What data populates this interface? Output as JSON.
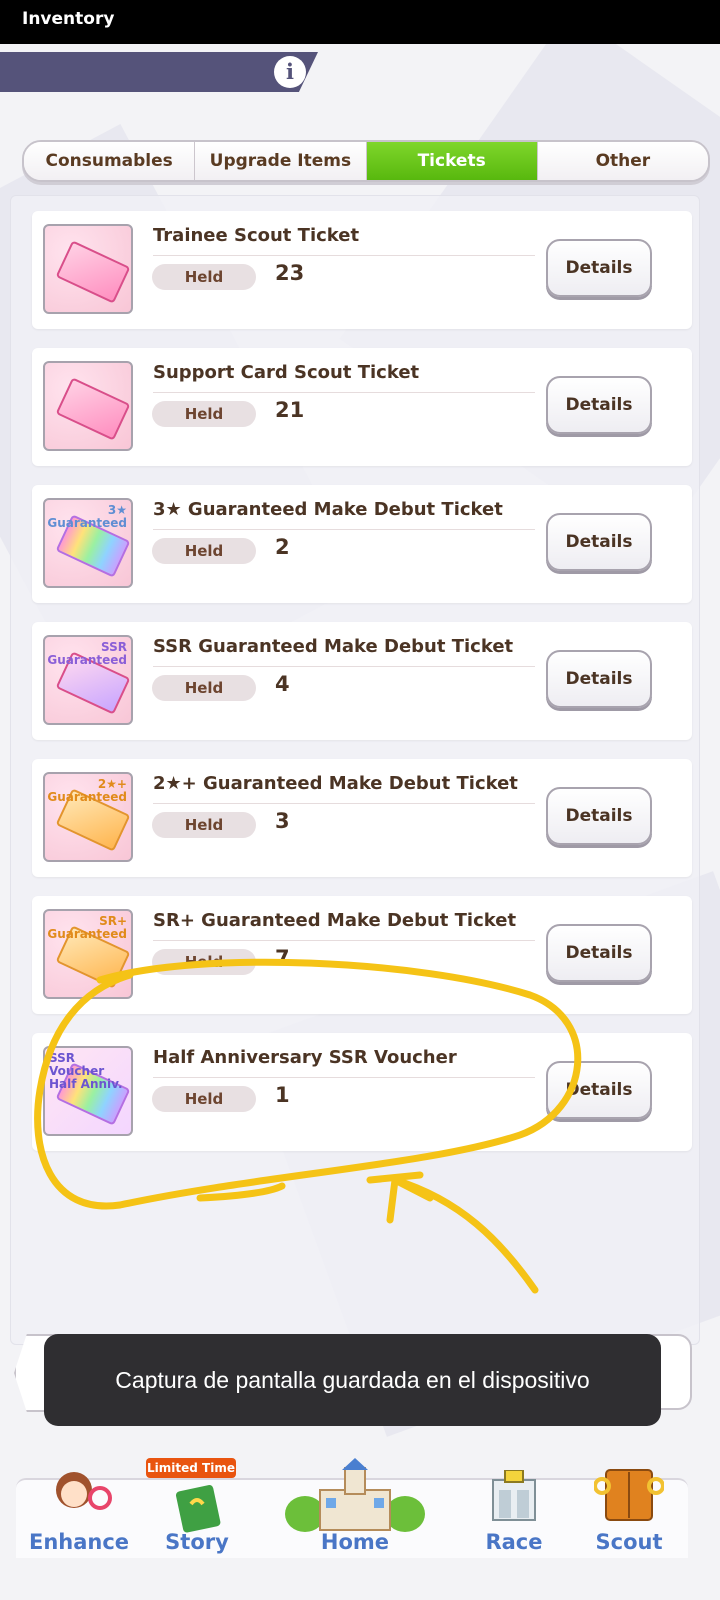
{
  "header": {
    "title": "Inventory",
    "info_icon": "info-icon",
    "info_glyph": "i"
  },
  "tabs": [
    {
      "label": "Consumables",
      "active": false
    },
    {
      "label": "Upgrade Items",
      "active": false
    },
    {
      "label": "Tickets",
      "active": true
    },
    {
      "label": "Other",
      "active": false
    }
  ],
  "colors": {
    "accent_tab": "#6cc81d",
    "banner": "#55537a",
    "annotation": "#f5c316",
    "toast_bg": "#2f2e31"
  },
  "items": [
    {
      "name": "Trainee Scout Ticket",
      "held_label": "Held",
      "count": "23",
      "details_label": "Details",
      "icon": "trainee-scout-ticket-icon"
    },
    {
      "name": "Support Card Scout Ticket",
      "held_label": "Held",
      "count": "21",
      "details_label": "Details",
      "icon": "support-card-scout-ticket-icon"
    },
    {
      "name": "3★ Guaranteed Make Debut Ticket",
      "held_label": "Held",
      "count": "2",
      "details_label": "Details",
      "icon": "three-star-guaranteed-ticket-icon",
      "tag": "3★",
      "tag2": "Guaranteed"
    },
    {
      "name": "SSR Guaranteed Make Debut Ticket",
      "held_label": "Held",
      "count": "4",
      "details_label": "Details",
      "icon": "ssr-guaranteed-ticket-icon",
      "tag": "SSR",
      "tag2": "Guaranteed"
    },
    {
      "name": "2★+ Guaranteed Make Debut Ticket",
      "held_label": "Held",
      "count": "3",
      "details_label": "Details",
      "icon": "two-star-plus-guaranteed-ticket-icon",
      "tag": "2★+",
      "tag2": "Guaranteed"
    },
    {
      "name": "SR+ Guaranteed Make Debut Ticket",
      "held_label": "Held",
      "count": "7",
      "details_label": "Details",
      "icon": "sr-plus-guaranteed-ticket-icon",
      "tag": "SR+",
      "tag2": "Guaranteed"
    },
    {
      "name": "Half Anniversary SSR Voucher",
      "held_label": "Held",
      "count": "1",
      "details_label": "Details",
      "icon": "half-anniversary-ssr-voucher-icon",
      "tag": "SSR Voucher",
      "tag2": "Half Anniv."
    }
  ],
  "toast": {
    "text": "Captura de pantalla guardada en el dispositivo"
  },
  "bottom_nav": [
    {
      "label": "Enhance",
      "icon": "enhance-character-icon"
    },
    {
      "label": "Story",
      "icon": "story-book-icon",
      "badge": "Limited Time"
    },
    {
      "label": "Home",
      "icon": "home-building-icon"
    },
    {
      "label": "Race",
      "icon": "race-gate-icon"
    },
    {
      "label": "Scout",
      "icon": "scout-door-icon"
    }
  ]
}
